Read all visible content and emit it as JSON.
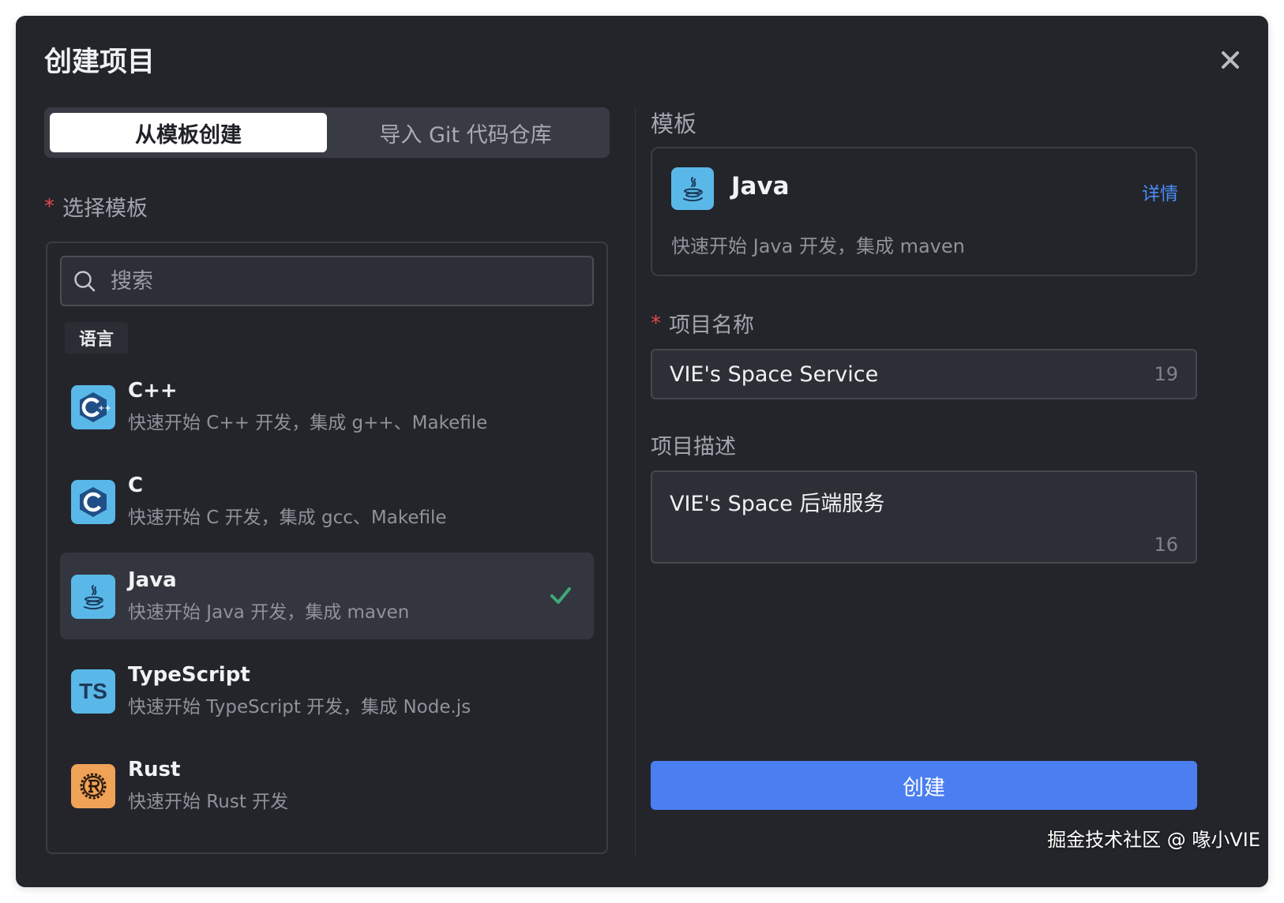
{
  "dialog": {
    "title": "创建项目"
  },
  "tabs": [
    {
      "label": "从模板创建",
      "active": true
    },
    {
      "label": "导入 Git 代码仓库",
      "active": false
    }
  ],
  "left": {
    "select_template_label": "选择模板",
    "search_placeholder": "搜索",
    "group_label": "语言",
    "templates": [
      {
        "name": "C++",
        "desc": "快速开始 C++ 开发，集成 g++、Makefile",
        "icon": "cpp-icon"
      },
      {
        "name": "C",
        "desc": "快速开始 C 开发，集成 gcc、Makefile",
        "icon": "c-icon"
      },
      {
        "name": "Java",
        "desc": "快速开始 Java 开发，集成 maven",
        "icon": "java-icon",
        "selected": true
      },
      {
        "name": "TypeScript",
        "desc": "快速开始 TypeScript 开发，集成 Node.js",
        "icon": "typescript-icon",
        "icon_text": "TS"
      },
      {
        "name": "Rust",
        "desc": "快速开始 Rust 开发",
        "icon": "rust-icon"
      }
    ]
  },
  "right": {
    "template_label": "模板",
    "preview": {
      "name": "Java",
      "detail_link": "详情",
      "desc": "快速开始 Java 开发，集成 maven"
    },
    "project_name_label": "项目名称",
    "project_name_value": "VIE's Space Service",
    "project_name_count": "19",
    "project_desc_label": "项目描述",
    "project_desc_value": "VIE's Space 后端服务",
    "project_desc_count": "16",
    "create_button": "创建"
  },
  "watermark": "掘金技术社区 @ 喙小VIE",
  "colors": {
    "background": "#23252b",
    "accent": "#4b7ef0",
    "link": "#4a8cf7",
    "required": "#e5484d",
    "check": "#3ea87a"
  }
}
